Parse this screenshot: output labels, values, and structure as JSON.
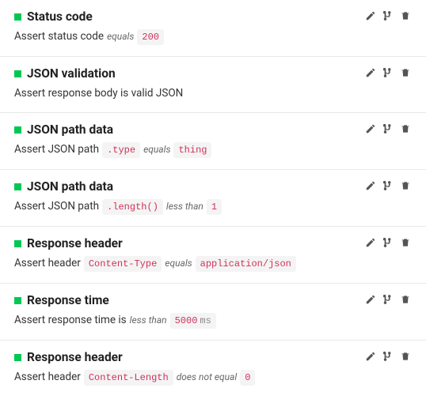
{
  "assertions": [
    {
      "title": "Status code",
      "prefix": "Assert status code",
      "operator": "equals",
      "value": "200",
      "unit": "",
      "path": ""
    },
    {
      "title": "JSON validation",
      "prefix": "Assert response body is valid JSON",
      "operator": "",
      "value": "",
      "unit": "",
      "path": ""
    },
    {
      "title": "JSON path data",
      "prefix": "Assert JSON path",
      "path": ".type",
      "operator": "equals",
      "value": "thing",
      "unit": ""
    },
    {
      "title": "JSON path data",
      "prefix": "Assert JSON path",
      "path": ".length()",
      "operator": "less than",
      "value": "1",
      "unit": ""
    },
    {
      "title": "Response header",
      "prefix": "Assert header",
      "path": "Content-Type",
      "operator": "equals",
      "value": "application/json",
      "unit": ""
    },
    {
      "title": "Response time",
      "prefix": "Assert response time is",
      "path": "",
      "operator": "less than",
      "value": "5000",
      "unit": "ms"
    },
    {
      "title": "Response header",
      "prefix": "Assert header",
      "path": "Content-Length",
      "operator": "does not equal",
      "value": "0",
      "unit": ""
    }
  ]
}
